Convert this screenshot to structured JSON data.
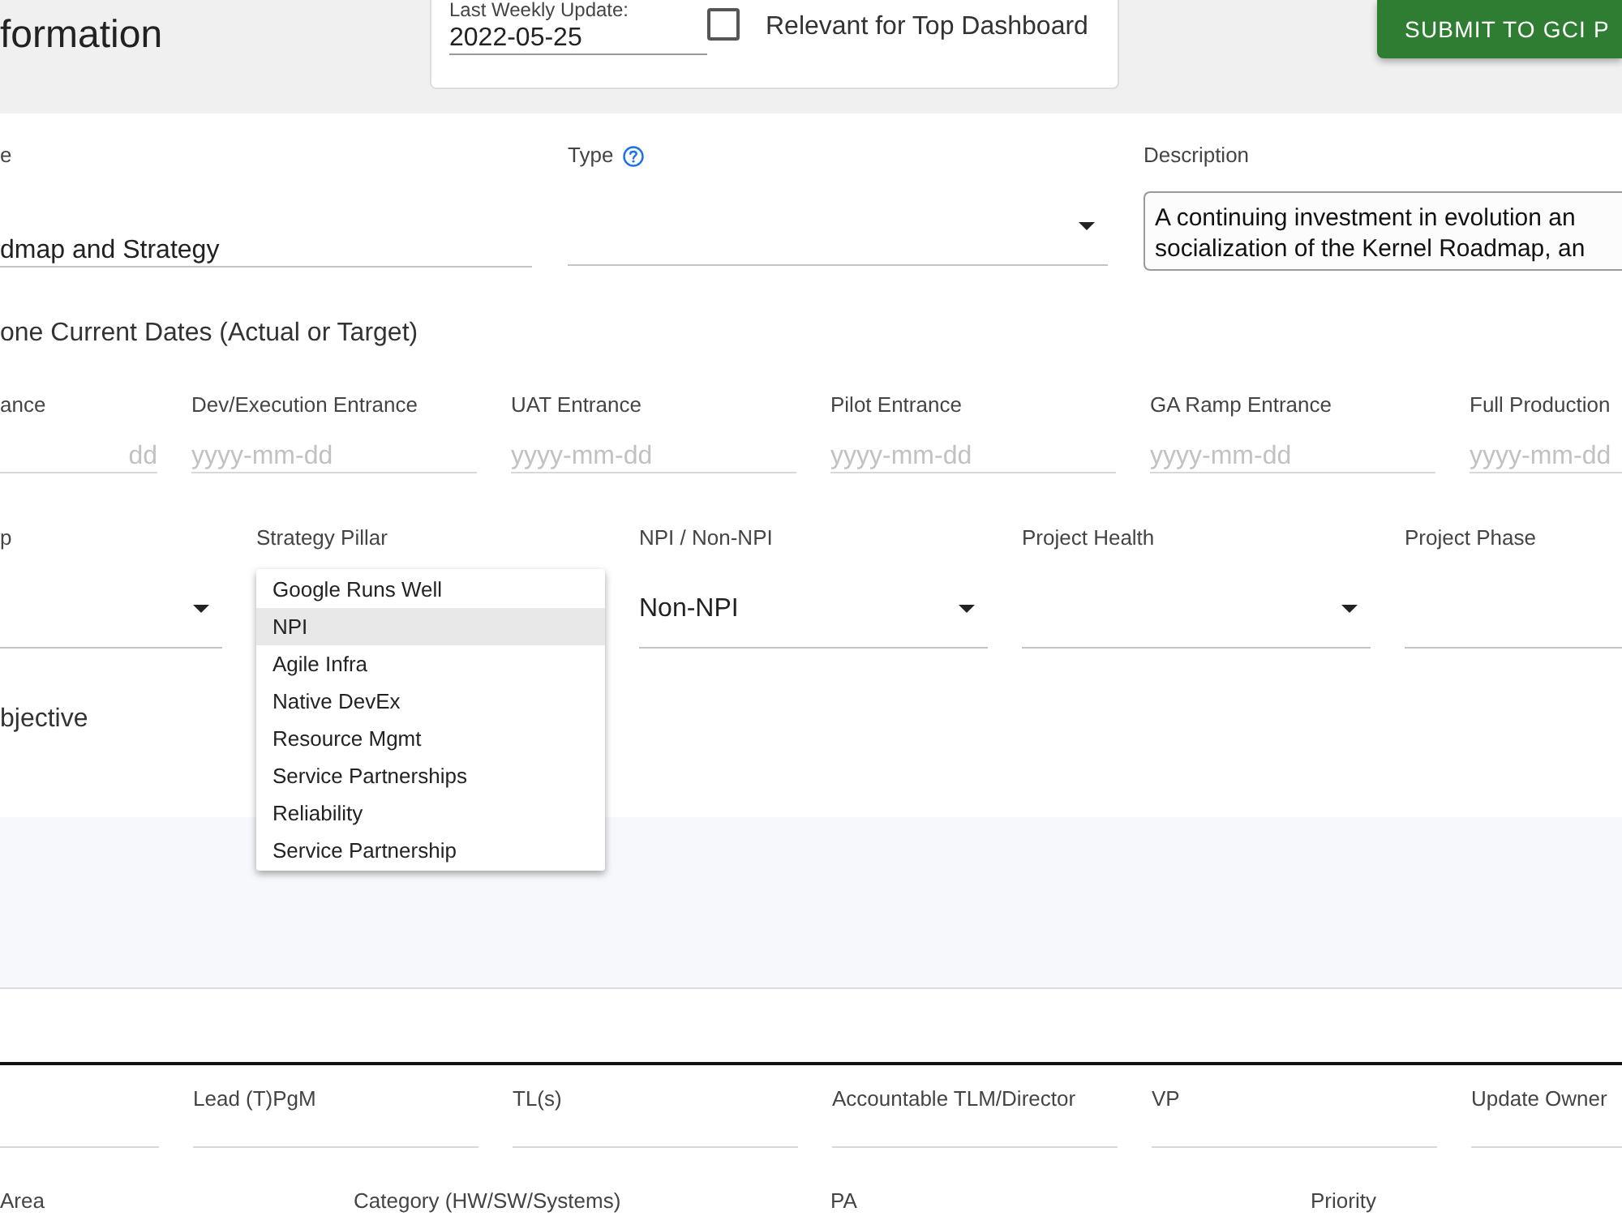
{
  "header": {
    "title": "formation",
    "weekly_update": {
      "label": "Last Weekly Update:",
      "value": "2022-05-25"
    },
    "top_dashboard": {
      "label": "Relevant for Top Dashboard",
      "checked": false
    },
    "submit_button": {
      "label": "SUBMIT TO GCI P"
    }
  },
  "details": [
    {
      "kind": "text",
      "label": "e",
      "value": "dmap and Strategy",
      "help": false
    },
    {
      "kind": "select",
      "label": "Type",
      "help": true
    },
    {
      "kind": "textarea",
      "label": "Description",
      "lines": [
        "A continuing investment in evolution an",
        "socialization of the Kernel Roadmap, an"
      ],
      "help": false
    }
  ],
  "milestones": {
    "title": "one Current Dates (Actual or Target)",
    "fields": [
      {
        "label": "ance",
        "placeholder": "dd"
      },
      {
        "label": "Dev/Execution Entrance",
        "placeholder": "yyyy-mm-dd"
      },
      {
        "label": "UAT Entrance",
        "placeholder": "yyyy-mm-dd"
      },
      {
        "label": "Pilot Entrance",
        "placeholder": "yyyy-mm-dd"
      },
      {
        "label": "GA Ramp Entrance",
        "placeholder": "yyyy-mm-dd"
      },
      {
        "label": "Full Production",
        "placeholder": "yyyy-mm-dd"
      }
    ]
  },
  "classification": [
    {
      "label": "p",
      "menu_open": false
    },
    {
      "label": "Strategy Pillar",
      "menu_open": true,
      "options": [
        {
          "label": "Google Runs Well",
          "selected": false
        },
        {
          "label": "NPI",
          "selected": true
        },
        {
          "label": "Agile Infra",
          "selected": false
        },
        {
          "label": "Native DevEx",
          "selected": false
        },
        {
          "label": "Resource Mgmt",
          "selected": false
        },
        {
          "label": "Service Partnerships",
          "selected": false
        },
        {
          "label": "Reliability",
          "selected": false
        },
        {
          "label": "Service Partnership",
          "selected": false
        }
      ]
    },
    {
      "label": "NPI / Non-NPI",
      "value": "Non-NPI",
      "menu_open": false
    },
    {
      "label": "Project Health",
      "menu_open": false
    },
    {
      "label": "Project Phase",
      "menu_open": false
    }
  ],
  "objective": {
    "title": "bjective"
  },
  "people": [
    {
      "kind": "text"
    },
    {
      "kind": "text",
      "label": "Lead (T)PgM"
    },
    {
      "kind": "text",
      "label": "TL(s)"
    },
    {
      "kind": "text",
      "label": "Accountable TLM/Director"
    },
    {
      "kind": "text",
      "label": "VP"
    },
    {
      "kind": "text",
      "label": "Update Owner"
    }
  ],
  "lower_fields": [
    {
      "label": "Area"
    },
    {
      "label": "Category (HW/SW/Systems)"
    },
    {
      "label": "PA"
    },
    {
      "label": "Priority"
    }
  ]
}
